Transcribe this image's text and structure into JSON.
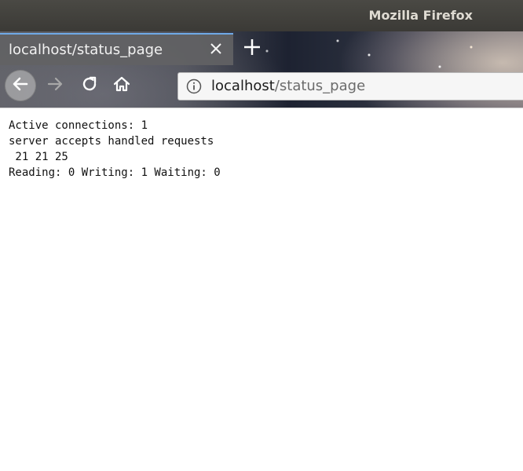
{
  "window": {
    "title": "Mozilla Firefox"
  },
  "tabs": [
    {
      "label": "localhost/status_page",
      "active": true,
      "close_icon": "close-icon"
    }
  ],
  "toolbar": {
    "new_tab_icon": "plus-icon",
    "back_icon": "arrow-left-icon",
    "forward_icon": "arrow-right-icon",
    "reload_icon": "reload-icon",
    "home_icon": "home-icon"
  },
  "urlbar": {
    "info_icon": "info-icon",
    "host": "localhost",
    "path": "/status_page"
  },
  "page": {
    "lines": [
      "Active connections: 1",
      "server accepts handled requests",
      " 21 21 25",
      "Reading: 0 Writing: 1 Waiting: 0"
    ]
  },
  "colors": {
    "titlebar": "#3b3a36",
    "tab_active": "#626264",
    "tab_accent": "#6fa9e6",
    "urlbar_bg": "#f6f6f6"
  }
}
